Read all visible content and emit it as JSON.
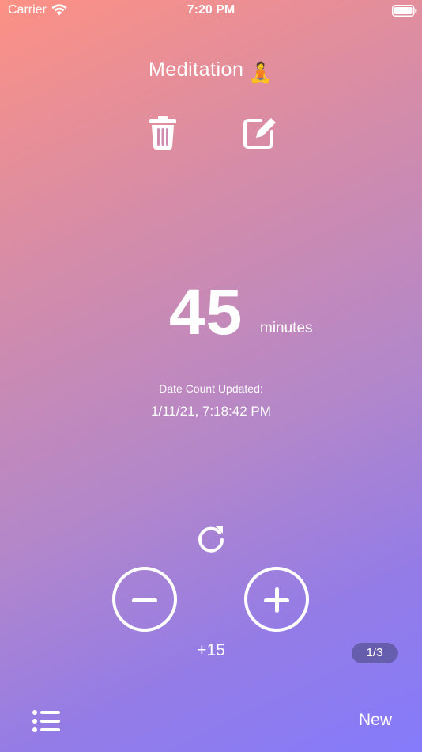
{
  "status_bar": {
    "carrier": "Carrier",
    "time": "7:20 PM"
  },
  "header": {
    "title": "Meditation",
    "title_emoji": "🧘"
  },
  "counter": {
    "value": "45",
    "unit": "minutes",
    "updated_label": "Date Count Updated:",
    "updated_value": "1/11/21, 7:18:42 PM",
    "step": "+15"
  },
  "pager": {
    "label": "1/3"
  },
  "toolbar": {
    "new_label": "New"
  },
  "icons": {
    "delete": "trash-icon",
    "edit": "edit-icon",
    "reset": "reset-icon",
    "decrement": "minus-circle-icon",
    "increment": "plus-circle-icon",
    "list": "list-icon"
  },
  "colors": {
    "gradient_start": "#fd9184",
    "gradient_end": "#857bfb",
    "foreground": "#ffffff",
    "badge_background": "#46467880"
  }
}
